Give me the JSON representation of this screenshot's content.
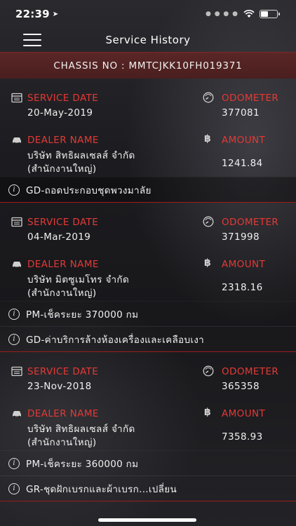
{
  "status": {
    "time": "22:39",
    "battery_level": 0.4
  },
  "header": {
    "title": "Service History"
  },
  "chassis": {
    "text": "CHASSIS NO : MMTCJKK10FH019371"
  },
  "labels": {
    "service_date": "SERVICE DATE",
    "odometer": "ODOMETER",
    "dealer_name": "DEALER NAME",
    "amount": "AMOUNT"
  },
  "records": [
    {
      "service_date": "20-May-2019",
      "odometer": "377081",
      "dealer_line1": "บริษัท สิทธิผลเซลส์ จำกัด",
      "dealer_line2": "(สำนักงานใหญ่)",
      "amount": "1241.84",
      "notes": [
        "GD-ถอดประกอบชุดพวงมาลัย"
      ]
    },
    {
      "service_date": "04-Mar-2019",
      "odometer": "371998",
      "dealer_line1": "บริษัท มิตซูเมโทร จำกัด",
      "dealer_line2": "(สำนักงานใหญ่)",
      "amount": "2318.16",
      "notes": [
        "PM-เช็คระยะ 370000  กม",
        "GD-ค่าบริการล้างห้องเครื่องและเคลือบเงา"
      ]
    },
    {
      "service_date": "23-Nov-2018",
      "odometer": "365358",
      "dealer_line1": "บริษัท สิทธิผลเซลส์ จำกัด",
      "dealer_line2": "(สำนักงานใหญ่)",
      "amount": "7358.93",
      "notes": [
        "PM-เช็คระยะ 360000  กม",
        "GR-ชุดฝักเบรกและผ้าเบรก...เปลี่ยน"
      ]
    }
  ],
  "icons": {
    "calendar": "calendar-icon",
    "odometer": "speedometer-icon",
    "car": "car-icon",
    "baht": "baht-icon",
    "info": "info-icon"
  },
  "colors": {
    "accent_red": "#e53935",
    "chassis_bar": "#4a1f1f"
  }
}
